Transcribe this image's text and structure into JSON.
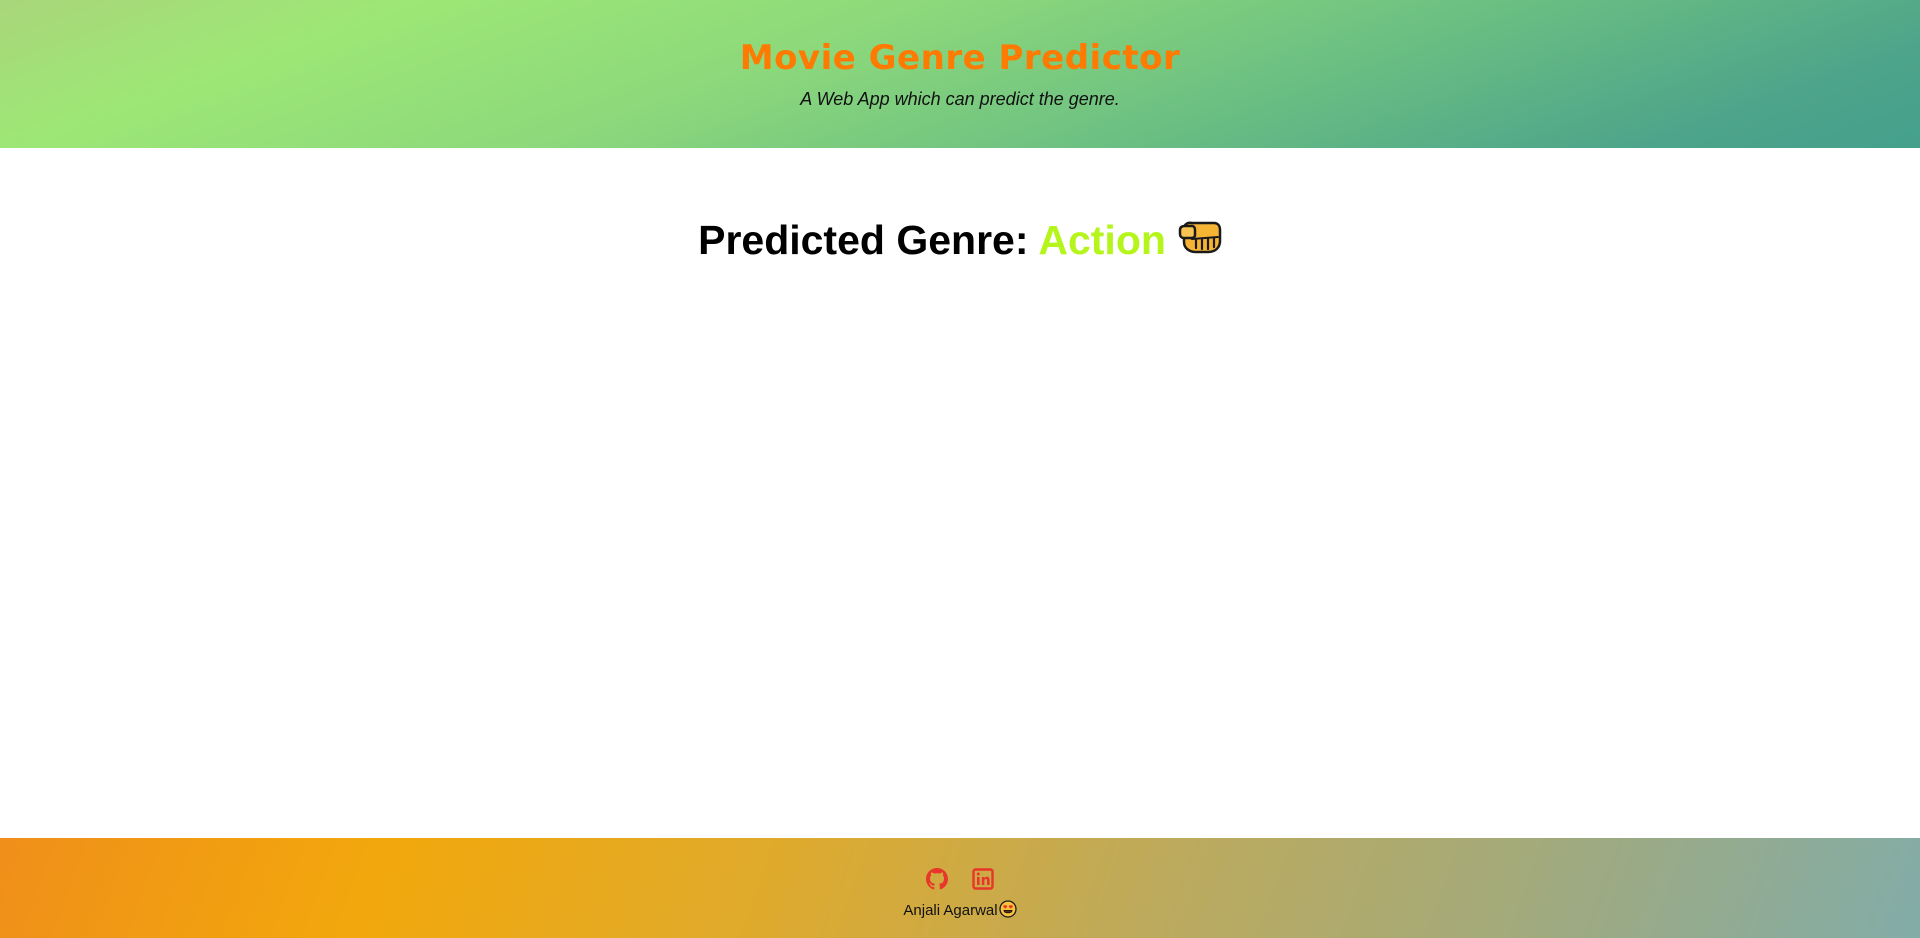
{
  "header": {
    "title": "Movie Genre Predictor",
    "subtitle": "A Web App which can predict the genre."
  },
  "main": {
    "prediction_label": "Predicted Genre:",
    "genre": "Action",
    "genre_icon": "oncoming-fist-icon",
    "genre_color": "#b5f51c"
  },
  "footer": {
    "social": [
      {
        "icon": "github-icon"
      },
      {
        "icon": "linkedin-icon"
      }
    ],
    "credit": "Anjali Agarwal",
    "credit_icon": "smiling-face-with-heart-eyes-icon",
    "icon_color": "#e8362a"
  },
  "colors": {
    "title": "#ff7a00",
    "header_gradient": [
      "#a9d67a",
      "#9de776",
      "#45a08c"
    ],
    "footer_gradient": [
      "#f08f1a",
      "#f2a80c",
      "#82aca8"
    ]
  }
}
